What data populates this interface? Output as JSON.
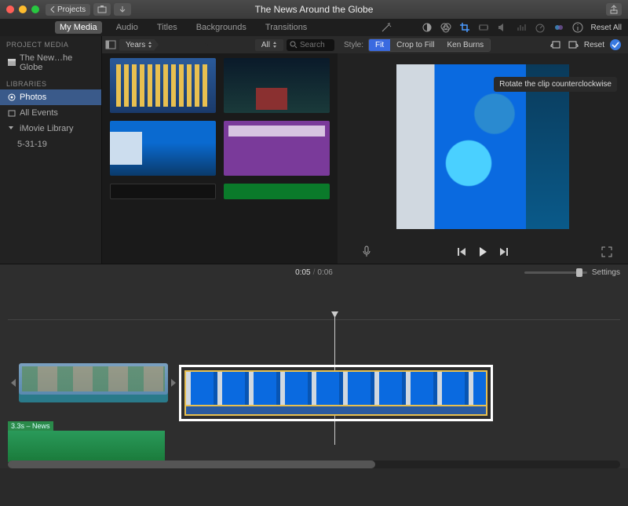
{
  "titlebar": {
    "back_label": "Projects",
    "title": "The News Around the Globe"
  },
  "tabs": {
    "items": [
      "My Media",
      "Audio",
      "Titles",
      "Backgrounds",
      "Transitions"
    ],
    "active_index": 0
  },
  "viewer_toolbar": {
    "reset_label": "Reset All",
    "style_label": "Style:",
    "seg": {
      "fit": "Fit",
      "crop": "Crop to Fill",
      "kenburns": "Ken Burns"
    },
    "reset_short": "Reset",
    "tooltip": "Rotate the clip counterclockwise"
  },
  "sidebar": {
    "project_media_label": "PROJECT MEDIA",
    "project_name": "The New…he Globe",
    "libraries_label": "LIBRARIES",
    "photos": "Photos",
    "all_events": "All Events",
    "imovie_lib": "iMovie Library",
    "date_event": "5-31-19"
  },
  "browser": {
    "crumb": "Years",
    "all_label": "All",
    "search_placeholder": "Search"
  },
  "timeline": {
    "time_current": "0:05",
    "time_total": "0:06",
    "settings_label": "Settings",
    "title_clip_label": "3.3s – News"
  }
}
